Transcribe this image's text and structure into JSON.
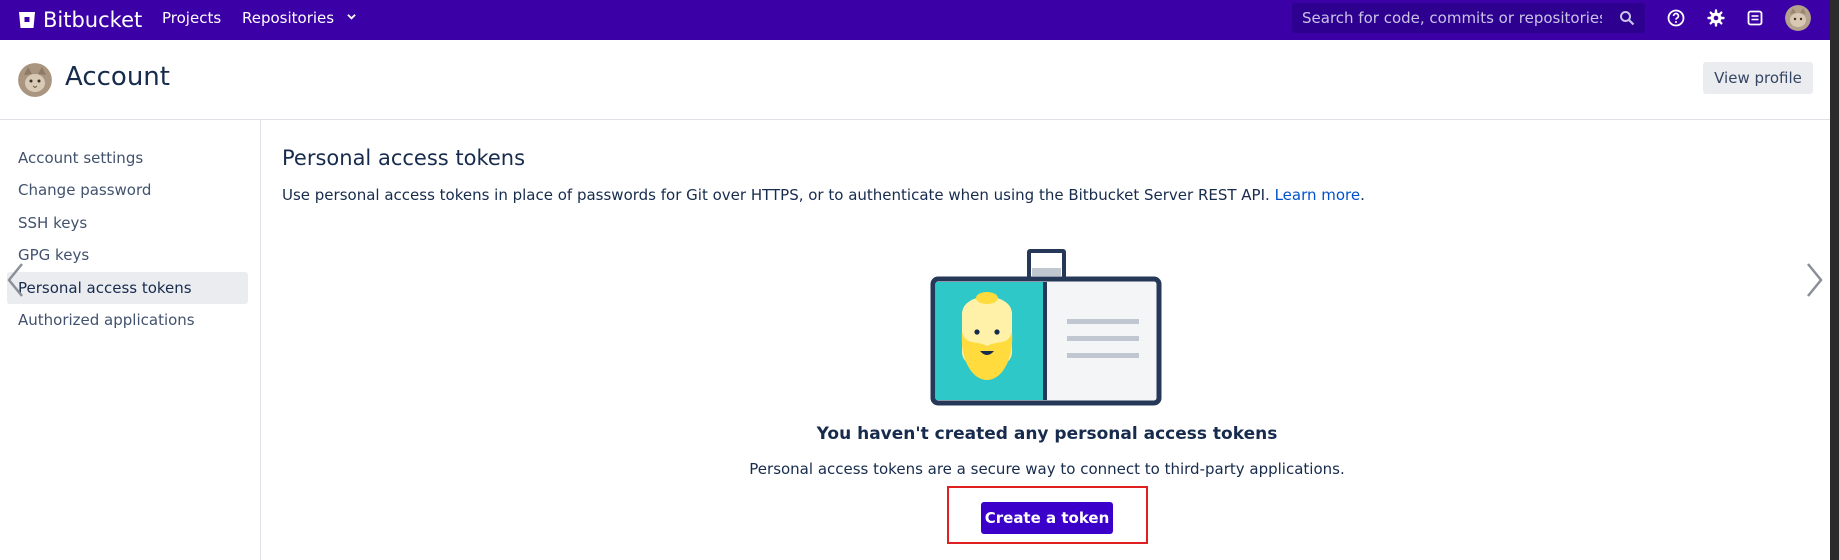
{
  "topbar": {
    "brand": "Bitbucket",
    "nav": [
      "Projects",
      "Repositories"
    ],
    "search_placeholder": "Search for code, commits or repositories...",
    "icons": [
      "help-icon",
      "gear-icon",
      "inbox-icon"
    ],
    "background_color": "#3b00a6"
  },
  "header": {
    "title": "Account",
    "view_profile_label": "View profile"
  },
  "sidebar": {
    "items": [
      {
        "label": "Account settings"
      },
      {
        "label": "Change password"
      },
      {
        "label": "SSH keys"
      },
      {
        "label": "GPG keys"
      },
      {
        "label": "Personal access tokens",
        "active": true
      },
      {
        "label": "Authorized applications"
      }
    ]
  },
  "main": {
    "title": "Personal access tokens",
    "description": "Use personal access tokens in place of passwords for Git over HTTPS, or to authenticate when using the Bitbucket Server REST API.",
    "learn_more": "Learn more",
    "description_end": ".",
    "empty_title": "You haven't created any personal access tokens",
    "empty_desc": "Personal access tokens are a secure way to connect to third-party applications.",
    "create_button": "Create a token",
    "accent_color": "#3b00c9",
    "highlight_color": "#e02020"
  }
}
